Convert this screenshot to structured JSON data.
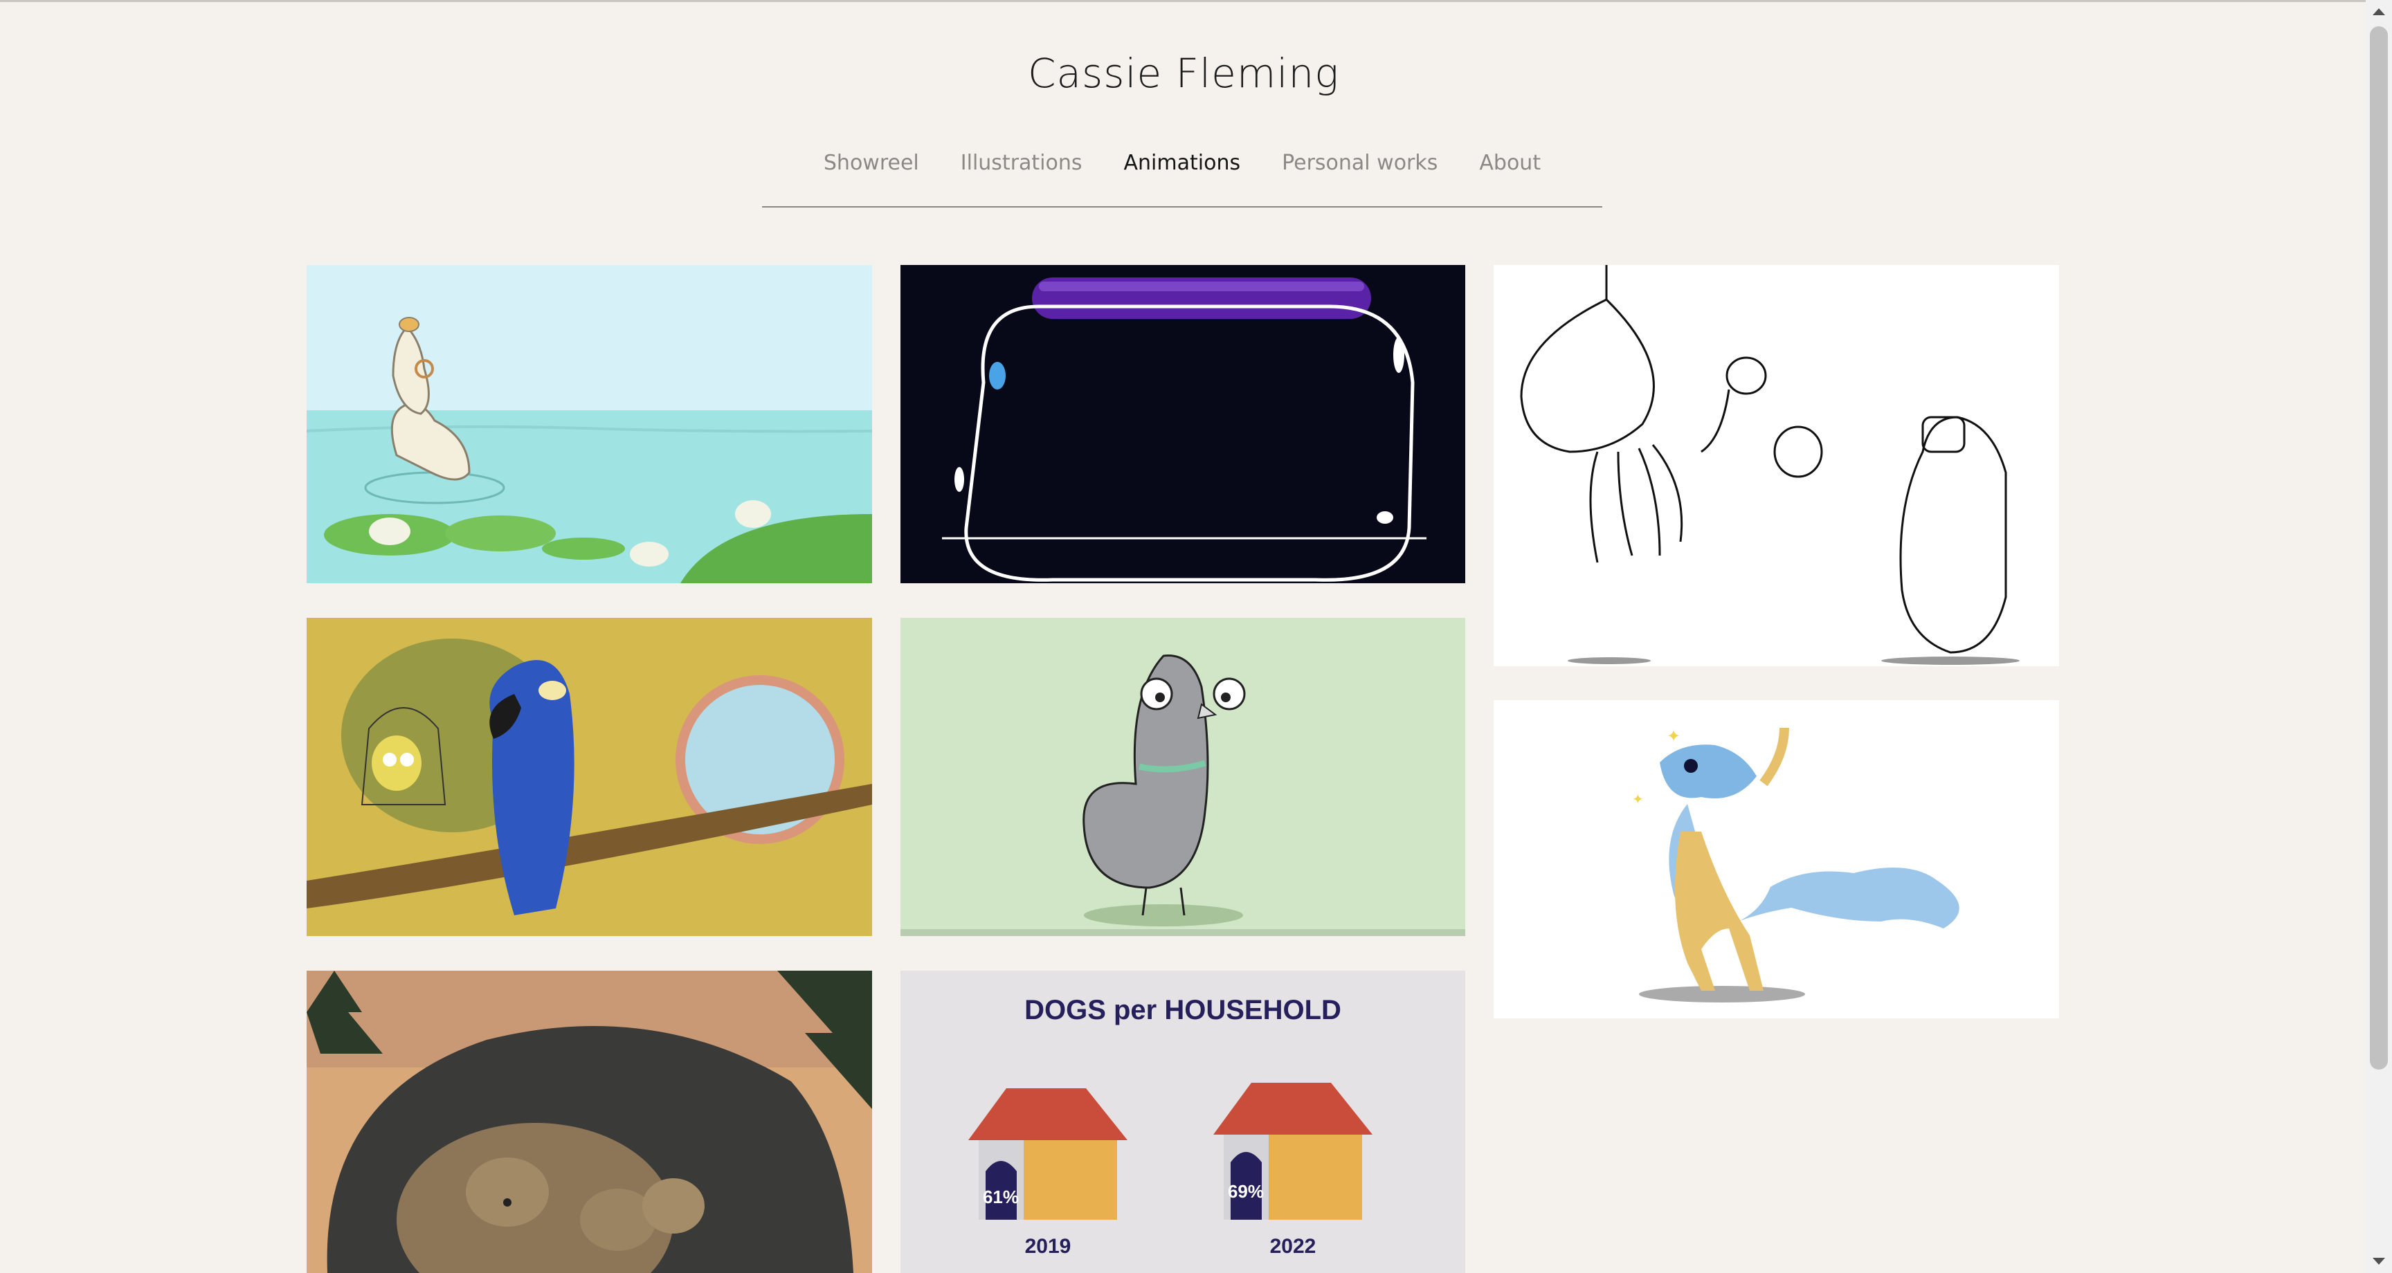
{
  "site": {
    "title": "Cassie Fleming"
  },
  "nav": {
    "items": [
      {
        "label": "Showreel",
        "active": false
      },
      {
        "label": "Illustrations",
        "active": false
      },
      {
        "label": "Animations",
        "active": true
      },
      {
        "label": "Personal works",
        "active": false
      },
      {
        "label": "About",
        "active": false
      }
    ]
  },
  "gallery": {
    "items": [
      {
        "name": "duck-pond-thumbnail",
        "icon": "duck-image"
      },
      {
        "name": "jar-thumbnail",
        "icon": "jar-image"
      },
      {
        "name": "spider-walk-thumbnail",
        "icon": "sketch-creatures-image"
      },
      {
        "name": "parrot-thumbnail",
        "icon": "parrots-image"
      },
      {
        "name": "pigeon-thumbnail",
        "icon": "pigeon-image"
      },
      {
        "name": "dragon-thumbnail",
        "icon": "dragon-image"
      },
      {
        "name": "bears-cave-thumbnail",
        "icon": "bears-image"
      },
      {
        "name": "dogs-infographic-thumbnail",
        "icon": "doghouse-image"
      }
    ],
    "infographic": {
      "title": "DOGS per HOUSEHOLD",
      "left_percent": "61%",
      "left_year": "2019",
      "right_percent": "69%",
      "right_year": "2022"
    }
  },
  "colors": {
    "background": "#f5f2ee",
    "nav_active": "#151515",
    "nav_inactive": "#8b8885"
  }
}
